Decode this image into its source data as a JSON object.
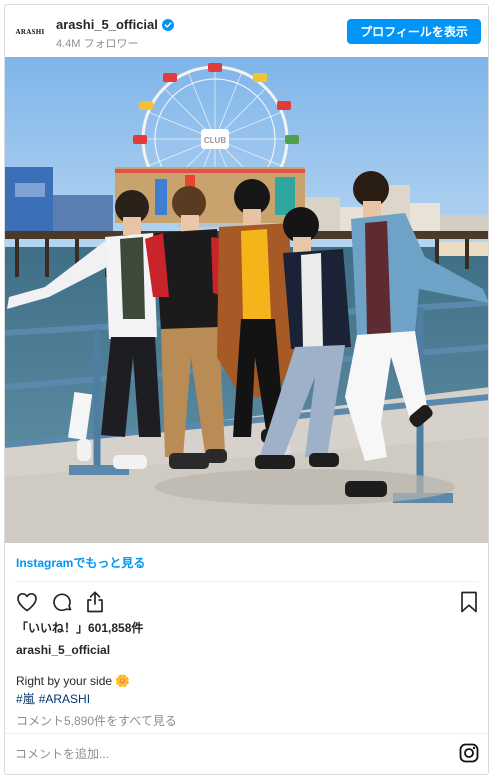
{
  "header": {
    "avatar_text": "ARASHI",
    "username": "arashi_5_official",
    "followers": "4.4M フォロワー",
    "profile_button": "プロフィールを表示"
  },
  "photo": {
    "sign_text": "CLUB",
    "icon": "photo"
  },
  "more_link": "Instagramでもっと見る",
  "actions": {
    "like_icon": "heart-icon",
    "comment_icon": "comment-icon",
    "share_icon": "share-icon",
    "save_icon": "bookmark-icon"
  },
  "likes": "「いいね！」601,858件",
  "caption": {
    "username": "arashi_5_official",
    "text": "Right by your side 🌼",
    "hashtags": [
      "#嵐",
      "#ARASHI"
    ]
  },
  "comments_link": "コメント5,890件をすべて見る",
  "comment_input": {
    "placeholder": "コメントを追加..."
  },
  "colors": {
    "accent": "#0095f6",
    "hashtag": "#00376b",
    "muted": "#8e8e8e",
    "text": "#262626"
  }
}
